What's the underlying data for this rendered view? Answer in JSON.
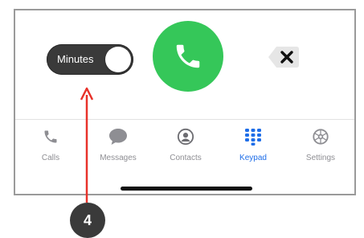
{
  "toggle": {
    "label": "Minutes",
    "state": "on"
  },
  "buttons": {
    "call": "phone-icon",
    "delete": "backspace-icon"
  },
  "tabs": [
    {
      "label": "Calls",
      "icon": "phone-icon",
      "active": false
    },
    {
      "label": "Messages",
      "icon": "chat-bubble-icon",
      "active": false
    },
    {
      "label": "Contacts",
      "icon": "person-circle-icon",
      "active": false
    },
    {
      "label": "Keypad",
      "icon": "keypad-grid-icon",
      "active": true
    },
    {
      "label": "Settings",
      "icon": "gear-icon",
      "active": false
    }
  ],
  "annotation": {
    "step": "4"
  },
  "colors": {
    "call": "#35c759",
    "active_tab": "#1f6ee8",
    "inactive_tab": "#8e8e93",
    "arrow": "#e8322a"
  }
}
